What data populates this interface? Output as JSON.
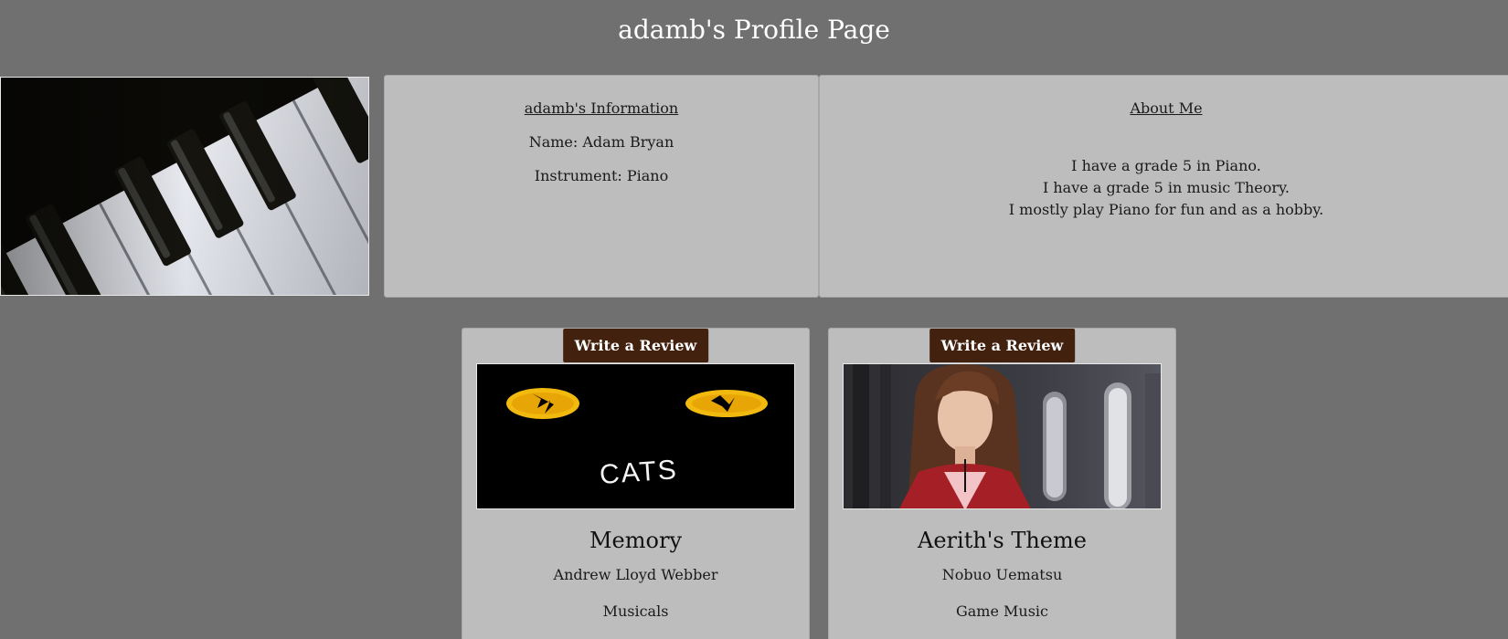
{
  "header": {
    "title": "adamb's Profile Page"
  },
  "profile": {
    "photo_icon": "piano-keys-image",
    "info": {
      "heading": "adamb's Information",
      "name": "Name: Adam Bryan",
      "instrument": "Instrument: Piano"
    },
    "about": {
      "heading": "About Me",
      "lines": [
        "I have a grade 5 in Piano.",
        "I have a grade 5 in music Theory.",
        "I mostly play Piano for fun and as a hobby."
      ]
    }
  },
  "songs": [
    {
      "button_label": "Write a Review",
      "image_icon": "cats-musical-artwork",
      "image_text": "CATS",
      "title": "Memory",
      "artist": "Andrew Lloyd Webber",
      "genre": "Musicals"
    },
    {
      "button_label": "Write a Review",
      "image_icon": "aerith-character-artwork",
      "title": "Aerith's Theme",
      "artist": "Nobuo Uematsu",
      "genre": "Game Music"
    }
  ],
  "colors": {
    "page_background": "#707070",
    "panel_background": "#bdbdbd",
    "button_background": "#42210f"
  }
}
